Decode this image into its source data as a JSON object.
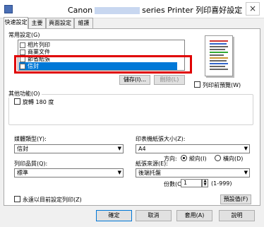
{
  "window": {
    "title_prefix": "Canon",
    "title_suffix": "series Printer 列印喜好設定",
    "close_glyph": "×"
  },
  "tabs": [
    {
      "label": "快速設定",
      "active": true
    },
    {
      "label": "主要",
      "active": false
    },
    {
      "label": "頁面設定",
      "active": false
    },
    {
      "label": "維護",
      "active": false
    }
  ],
  "common_settings": {
    "label": "常用設定(G)",
    "items": [
      {
        "label": "相片列印"
      },
      {
        "label": "商業文件"
      },
      {
        "label": "節省紙張"
      },
      {
        "label": "信封",
        "selected": true
      }
    ],
    "save_button": "儲存(I)...",
    "delete_button": "刪除(L)"
  },
  "preview_checkbox": "列印前預覽(W)",
  "other_features": {
    "label": "其他功能(O)",
    "rotate_180": "旋轉 180 度"
  },
  "media_type": {
    "label": "媒體類型(Y):",
    "value": "信封"
  },
  "paper_size": {
    "label": "印表機紙張大小(Z):",
    "value": "A4"
  },
  "orientation": {
    "label": "方向:",
    "portrait": "縱向(I)",
    "landscape": "橫向(D)",
    "selected": "portrait"
  },
  "print_quality": {
    "label": "列印品質(Q):",
    "value": "標準"
  },
  "paper_source": {
    "label": "紙張來源(E):",
    "value": "後端托盤"
  },
  "copies": {
    "label": "份數(C):",
    "value": "1",
    "range": "(1-999)"
  },
  "always_print": "永遠以目前設定列印(Z)",
  "defaults_button": "預設值(F)",
  "footer": {
    "ok": "確定",
    "cancel": "取消",
    "apply": "套用(A)",
    "help": "說明"
  }
}
